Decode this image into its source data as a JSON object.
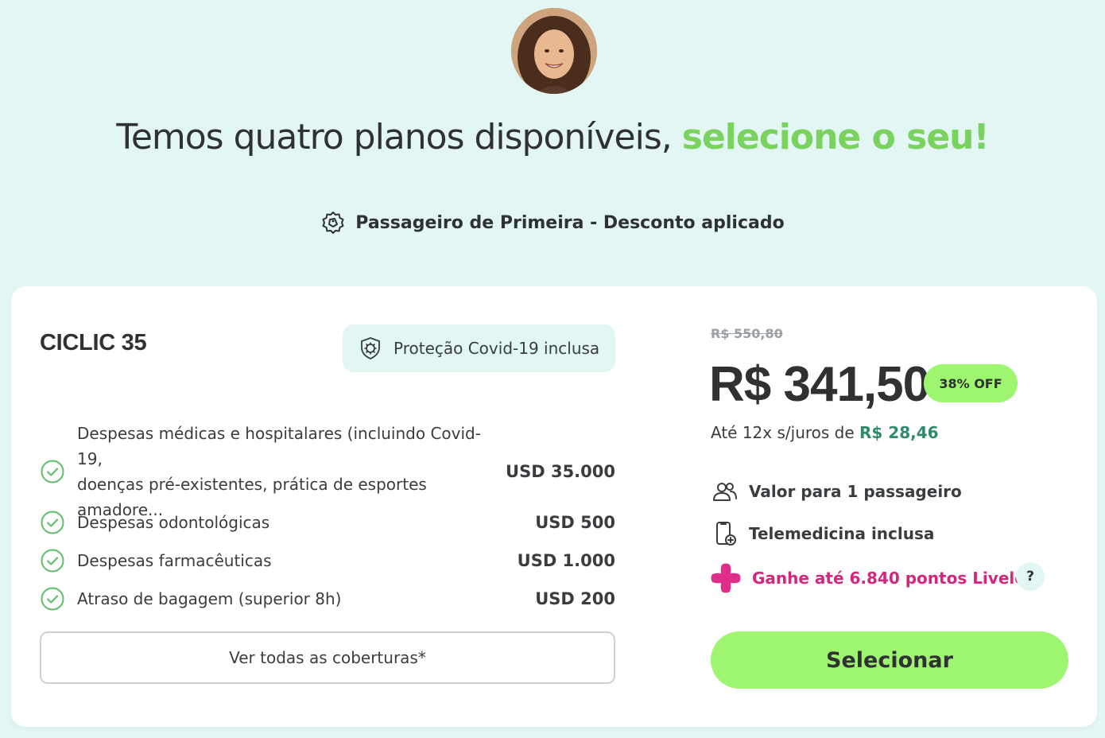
{
  "header": {
    "title_main": "Temos quatro planos disponíveis, ",
    "title_accent": "selecione o seu!",
    "discount_label": "Passageiro de Primeira - Desconto aplicado"
  },
  "plan": {
    "name": "CICLIC 35",
    "covid_badge": "Proteção Covid-19 inclusa",
    "coverages": [
      {
        "label_line1": "Despesas médicas e hospitalares (incluindo Covid-19,",
        "label_line2": "doenças pré-existentes, prática de esportes amadore...",
        "value": "USD 35.000"
      },
      {
        "label": "Despesas odontológicas",
        "value": "USD 500"
      },
      {
        "label": "Despesas farmacêuticas",
        "value": "USD 1.000"
      },
      {
        "label": "Atraso de bagagem (superior 8h)",
        "value": "USD 200"
      }
    ],
    "see_all_label": "Ver todas as coberturas*",
    "old_price": "R$ 550,80",
    "price": "R$ 341,50",
    "off_badge": "38% OFF",
    "installments_prefix": "Até 12x s/juros de ",
    "installments_amount": "R$ 28,46",
    "features": {
      "passengers": "Valor para 1 passageiro",
      "telemedicine": "Telemedicina inclusa",
      "points": "Ganhe até 6.840 pontos Livelo"
    },
    "help_label": "?",
    "select_label": "Selecionar"
  },
  "colors": {
    "background": "#e2f6f4",
    "accent_green": "#7ad35e",
    "button_green": "#9ef56f",
    "installment_green": "#2e8b6e",
    "livelo_pink": "#d4267e"
  },
  "icons": {
    "discount": "tag-badge-icon",
    "covid": "virus-shield-icon",
    "check": "check-circle-icon",
    "passengers": "users-icon",
    "telemedicine": "phone-plus-icon",
    "livelo": "livelo-plus-icon"
  }
}
